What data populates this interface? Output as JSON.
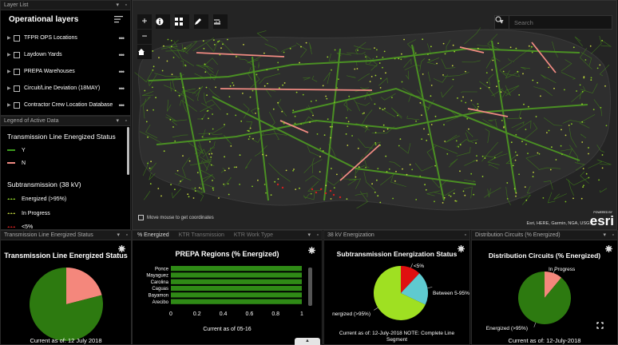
{
  "layer_list": {
    "panel_title": "Layer List",
    "heading": "Operational layers",
    "items": [
      {
        "label": "TFPR OPS Locations"
      },
      {
        "label": "Laydown Yards"
      },
      {
        "label": "PREPA Warehouses"
      },
      {
        "label": "Circuit/Line Deviation (18MAY)"
      },
      {
        "label": "Contractor Crew Location Database"
      }
    ]
  },
  "legend": {
    "panel_title": "Legend of Active Data",
    "group1_title": "Transmission Line Energized Status",
    "group1_items": [
      {
        "label": "Y",
        "color": "#3c9a1c"
      },
      {
        "label": "N",
        "color": "#f08a82"
      }
    ],
    "group2_title": "Subtransmission (38 kV)",
    "group2_items": [
      {
        "label": "Energized (>95%)",
        "color": "#8ed12a"
      },
      {
        "label": "In Progress",
        "color": "#b5c83a"
      },
      {
        "label": "<5%",
        "color": "#d02020"
      }
    ]
  },
  "map": {
    "search_placeholder": "Search",
    "coord_hint": "Move mouse to get coordinates",
    "attribution": "Esri, HERE, Garmin, NGA, USGS",
    "powered_by": "POWERED BY",
    "logo_text": "esri",
    "tools": [
      "zoom-in",
      "zoom-out",
      "home",
      "info",
      "basemap-gallery",
      "draw",
      "measure"
    ]
  },
  "widget1": {
    "panel_title": "Transmission Line Energized Status",
    "title": "Transmission Line Energized Status",
    "footer": "Current as of: 12 July 2018"
  },
  "widget2": {
    "tabs": [
      "% Energized",
      "KTR Transmission",
      "KTR Work Type"
    ],
    "title": "PREPA Regions (% Energized)",
    "footer": "Current as of 05-16"
  },
  "widget3": {
    "panel_title": "38 kV Energization",
    "title": "Subtransmission Energization Status",
    "footer_line1": "Current as of: 12-July-2018 NOTE: Complete Line",
    "footer_line2": "Segment"
  },
  "widget4": {
    "panel_title": "Distribution Circuits (% Energized)",
    "title": "Distribution Circuits (% Energized)",
    "footer": "Current as of: 12-July-2018"
  },
  "chart_data": [
    {
      "type": "pie",
      "title": "Transmission Line Energized Status",
      "slices": [
        {
          "label": "Y",
          "value": 0.79,
          "color": "#2d7a10"
        },
        {
          "label": "N",
          "value": 0.21,
          "color": "#f4877c"
        }
      ]
    },
    {
      "type": "bar",
      "orientation": "horizontal",
      "title": "PREPA Regions (% Energized)",
      "categories": [
        "Ponce",
        "Mayaguez",
        "Carolina",
        "Caguas",
        "Bayamon",
        "Arecibo"
      ],
      "values": [
        1,
        1,
        1,
        1,
        1,
        1
      ],
      "xlim": [
        0,
        1
      ],
      "xticks": [
        "0",
        "0.2",
        "0.4",
        "0.6",
        "0.8",
        "1"
      ],
      "color": "#2f8a16"
    },
    {
      "type": "pie",
      "title": "Subtransmission Energization Status",
      "slices": [
        {
          "label": "nergized (>95%)",
          "value": 0.68,
          "color": "#9fe022"
        },
        {
          "label": "<5%",
          "value": 0.12,
          "color": "#e01010"
        },
        {
          "label": "Between 5-95%",
          "value": 0.2,
          "color": "#5fcad0"
        }
      ]
    },
    {
      "type": "pie",
      "title": "Distribution Circuits (% Energized)",
      "slices": [
        {
          "label": "Energized (>95%)",
          "value": 0.89,
          "color": "#2d7a10"
        },
        {
          "label": "In Progress",
          "value": 0.11,
          "color": "#f4877c"
        }
      ]
    }
  ]
}
